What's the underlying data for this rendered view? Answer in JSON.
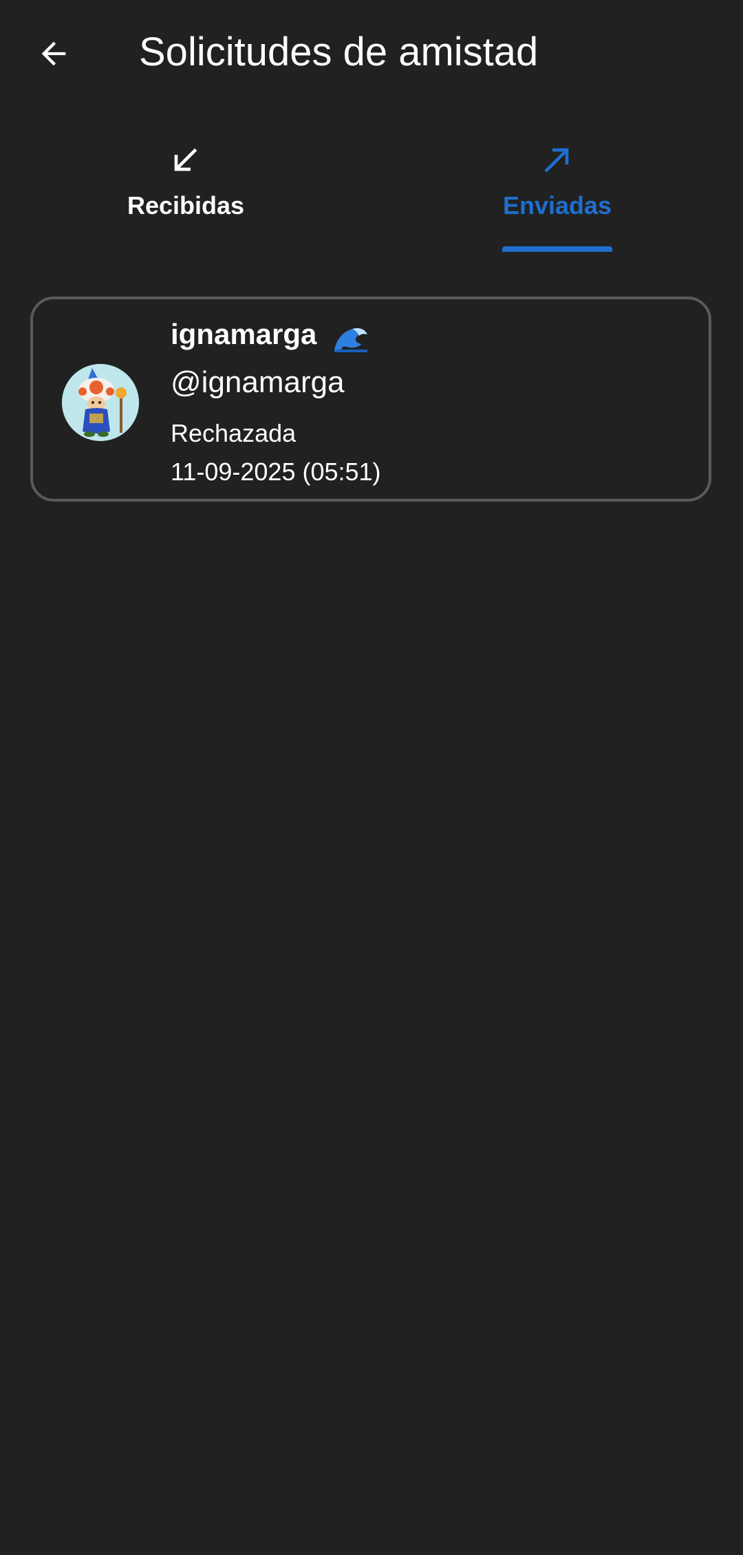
{
  "app": {
    "title": "Solicitudes de amistad"
  },
  "icons": {
    "back": "arrow-back-icon",
    "received": "arrow-down-left-icon",
    "sent": "arrow-up-right-icon",
    "wave": "water-wave-emoji"
  },
  "colors": {
    "background": "#212121",
    "accent": "#1e6fd0",
    "text": "#ffffff",
    "card_border": "#5a5a5a"
  },
  "tabs": [
    {
      "label": "Recibidas",
      "selected": false
    },
    {
      "label": "Enviadas",
      "selected": true
    }
  ],
  "requests": [
    {
      "display_name": "ignamarga",
      "handle": "@ignamarga",
      "status": "Rechazada",
      "date": "11-09-2025 (05:51)"
    }
  ]
}
